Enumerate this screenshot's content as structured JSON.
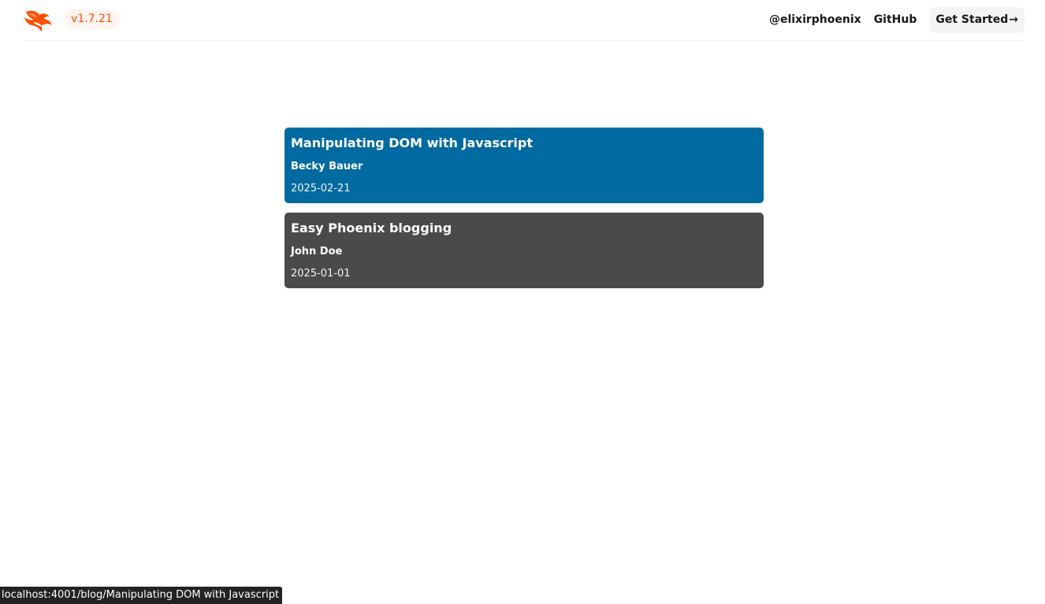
{
  "header": {
    "logo_icon": "phoenix-logo-icon",
    "version": "v1.7.21",
    "links": {
      "twitter": "@elixirphoenix",
      "github": "GitHub",
      "get_started": "Get Started",
      "get_started_icon": "→"
    }
  },
  "posts": [
    {
      "title": "Manipulating DOM with Javascript",
      "author": "Becky Bauer",
      "date": "2025-02-21"
    },
    {
      "title": "Easy Phoenix blogging",
      "author": "John Doe",
      "date": "2025-01-01"
    }
  ],
  "status_bar": {
    "url": "localhost:4001/blog/Manipulating DOM with Javascript"
  },
  "colors": {
    "brand": "#fd4f00",
    "active_card": "#006aa1",
    "inactive_card": "#4a4a4a"
  }
}
